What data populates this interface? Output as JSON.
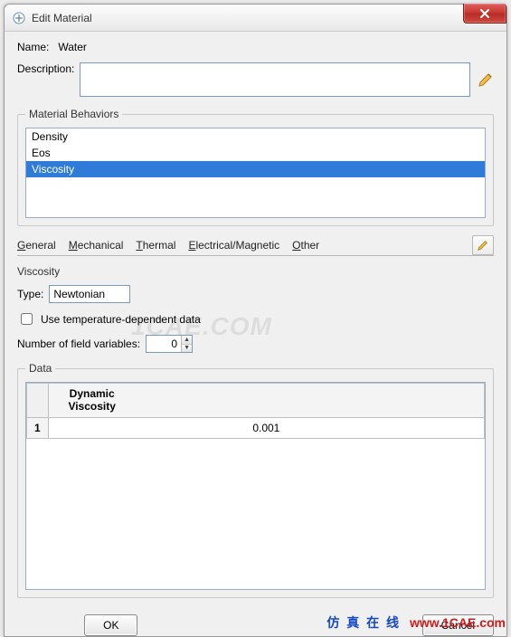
{
  "window": {
    "title": "Edit Material"
  },
  "form": {
    "name_label": "Name:",
    "name_value": "Water",
    "description_label": "Description:",
    "description_value": ""
  },
  "behaviors": {
    "legend": "Material Behaviors",
    "items": [
      "Density",
      "Eos",
      "Viscosity"
    ],
    "selected_index": 2
  },
  "menubar": {
    "general": "General",
    "mechanical": "Mechanical",
    "thermal": "Thermal",
    "electrical": "Electrical/Magnetic",
    "other": "Other"
  },
  "viscosity": {
    "section_title": "Viscosity",
    "type_label": "Type:",
    "type_value": "Newtonian",
    "temp_dep_label": "Use temperature-dependent data",
    "temp_dep_checked": false,
    "nfv_label": "Number of field variables:",
    "nfv_value": "0"
  },
  "data": {
    "legend": "Data",
    "columns": [
      "Dynamic Viscosity"
    ],
    "rows": [
      {
        "index": "1",
        "values": [
          "0.001"
        ]
      }
    ]
  },
  "buttons": {
    "ok": "OK",
    "cancel": "Cancel"
  },
  "branding": {
    "watermark": "1CAE.COM",
    "cn": "仿 真 在 线",
    "url": "www.1CAE.com"
  }
}
